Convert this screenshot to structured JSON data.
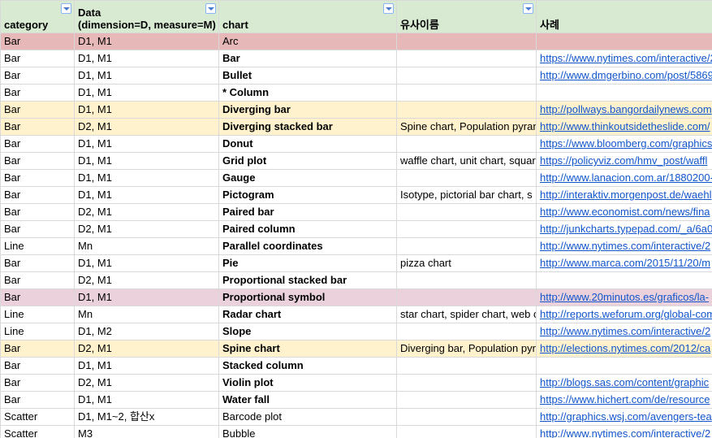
{
  "headers": [
    "category",
    "Data\n(dimension=D, measure=M)",
    "chart",
    "유사이름",
    "사례"
  ],
  "header_lines": {
    "h0": "category",
    "h1a": "Data",
    "h1b": "(dimension=D, measure=M)",
    "h2": "chart",
    "h3": "유사이름",
    "h4": "사례"
  },
  "highlight_colors": {
    "red": "#e6b8b7",
    "yellow": "#fff2cc",
    "pink": "#ead1dc",
    "header": "#d9ead3",
    "link": "#1155cc"
  },
  "rows": [
    {
      "category": "Bar",
      "data": "D1, M1",
      "chart": "Arc",
      "similar": "",
      "example": "",
      "bold": false,
      "hl": "red"
    },
    {
      "category": "Bar",
      "data": "D1, M1",
      "chart": "Bar",
      "similar": "",
      "example": "https://www.nytimes.com/interactive/2",
      "bold": true,
      "hl": ""
    },
    {
      "category": "Bar",
      "data": "D1, M1",
      "chart": "Bullet",
      "similar": "",
      "example": "http://www.dmgerbino.com/post/5869",
      "bold": true,
      "hl": ""
    },
    {
      "category": "Bar",
      "data": "D1, M1",
      "chart": "* Column",
      "similar": "",
      "example": "",
      "bold": true,
      "hl": ""
    },
    {
      "category": "Bar",
      "data": "D1, M1",
      "chart": "Diverging bar",
      "similar": "",
      "example": "http://pollways.bangordailynews.com",
      "bold": true,
      "hl": "yellow"
    },
    {
      "category": "Bar",
      "data": "D2, M1",
      "chart": "Diverging stacked bar",
      "similar": "Spine chart, Population pyramid",
      "example": "http://www.thinkoutsidetheslide.com/",
      "bold": true,
      "hl": "yellow"
    },
    {
      "category": "Bar",
      "data": "D1, M1",
      "chart": "Donut",
      "similar": "",
      "example": "https://www.bloomberg.com/graphics",
      "bold": true,
      "hl": ""
    },
    {
      "category": "Bar",
      "data": "D1, M1",
      "chart": "Grid plot",
      "similar": "waffle chart, unit chart, square",
      "example": "https://policyviz.com/hmv_post/waffl",
      "bold": true,
      "hl": ""
    },
    {
      "category": "Bar",
      "data": "D1, M1",
      "chart": "Gauge",
      "similar": "",
      "example": "http://www.lanacion.com.ar/1880200-",
      "bold": true,
      "hl": ""
    },
    {
      "category": "Bar",
      "data": "D1, M1",
      "chart": "Pictogram",
      "similar": "Isotype, pictorial bar chart, s",
      "example": "http://interaktiv.morgenpost.de/waehl",
      "bold": true,
      "hl": ""
    },
    {
      "category": "Bar",
      "data": "D2, M1",
      "chart": "Paired bar",
      "similar": "",
      "example": "http://www.economist.com/news/fina",
      "bold": true,
      "hl": ""
    },
    {
      "category": "Bar",
      "data": "D2, M1",
      "chart": "Paired column",
      "similar": "",
      "example": "http://junkcharts.typepad.com/_a/6a0",
      "bold": true,
      "hl": ""
    },
    {
      "category": "Line",
      "data": "Mn",
      "chart": "Parallel coordinates",
      "similar": "",
      "example": "http://www.nytimes.com/interactive/2",
      "bold": true,
      "hl": ""
    },
    {
      "category": "Bar",
      "data": "D1, M1",
      "chart": "Pie",
      "similar": "pizza chart",
      "example": "http://www.marca.com/2015/11/20/m",
      "bold": true,
      "hl": ""
    },
    {
      "category": "Bar",
      "data": "D2, M1",
      "chart": "Proportional stacked bar",
      "similar": "",
      "example": "",
      "bold": true,
      "hl": ""
    },
    {
      "category": "Bar",
      "data": "D1, M1",
      "chart": "Proportional symbol",
      "similar": "",
      "example": "http://www.20minutos.es/graficos/la-",
      "bold": true,
      "hl": "pink"
    },
    {
      "category": "Line",
      "data": "Mn",
      "chart": "Radar chart",
      "similar": "star chart, spider chart, web c",
      "example": "http://reports.weforum.org/global-com",
      "bold": true,
      "hl": ""
    },
    {
      "category": "Line",
      "data": "D1, M2",
      "chart": "Slope",
      "similar": "",
      "example": "http://www.nytimes.com/interactive/2",
      "bold": true,
      "hl": ""
    },
    {
      "category": "Bar",
      "data": "D2, M1",
      "chart": "Spine chart",
      "similar": "Diverging bar, Population pyramid",
      "example": "http://elections.nytimes.com/2012/ca",
      "bold": true,
      "hl": "yellow"
    },
    {
      "category": "Bar",
      "data": "D1, M1",
      "chart": "Stacked column",
      "similar": "",
      "example": "",
      "bold": true,
      "hl": ""
    },
    {
      "category": "Bar",
      "data": "D2, M1",
      "chart": "Violin plot",
      "similar": "",
      "example": "http://blogs.sas.com/content/graphic",
      "bold": true,
      "hl": ""
    },
    {
      "category": "Bar",
      "data": "D1, M1",
      "chart": "Water fall",
      "similar": "",
      "example": "https://www.hichert.com/de/resource",
      "bold": true,
      "hl": ""
    },
    {
      "category": "Scatter",
      "data": "D1, M1~2, 합산x",
      "chart": "Barcode plot",
      "similar": "",
      "example": "http://graphics.wsj.com/avengers-tea",
      "bold": false,
      "hl": ""
    },
    {
      "category": "Scatter",
      "data": "M3",
      "chart": "Bubble",
      "similar": "",
      "example": "http://www.nytimes.com/interactive/2",
      "bold": false,
      "hl": ""
    }
  ]
}
